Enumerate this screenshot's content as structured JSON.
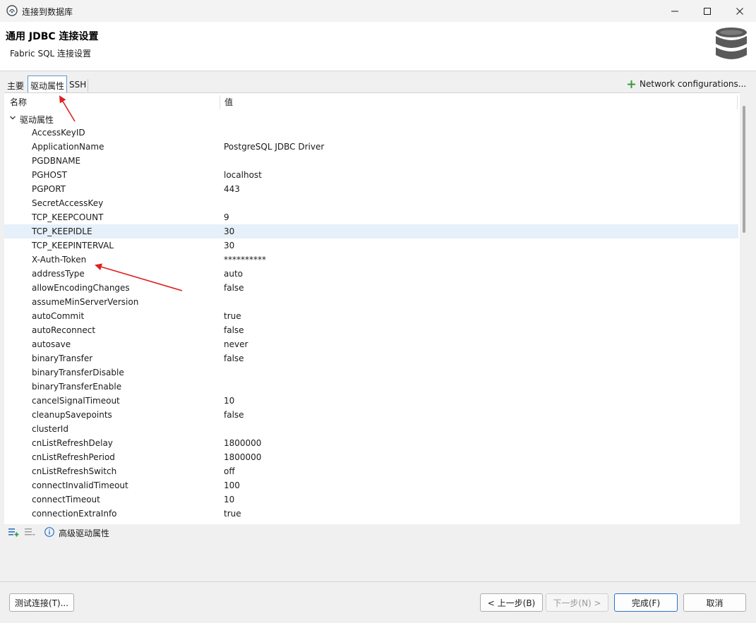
{
  "window": {
    "title": "连接到数据库",
    "accent_color": "#2a72c8"
  },
  "header": {
    "title": "通用 JDBC 连接设置",
    "subtitle": "Fabric SQL 连接设置"
  },
  "tabs": [
    {
      "label": "主要"
    },
    {
      "label": "驱动属性",
      "active": true
    },
    {
      "label": "SSH"
    }
  ],
  "network_configurations": "Network configurations...",
  "table": {
    "col_name": "名称",
    "col_value": "值",
    "group": "驱动属性",
    "rows": [
      {
        "name": "AccessKeyID",
        "value": ""
      },
      {
        "name": "ApplicationName",
        "value": "PostgreSQL JDBC Driver"
      },
      {
        "name": "PGDBNAME",
        "value": ""
      },
      {
        "name": "PGHOST",
        "value": "localhost"
      },
      {
        "name": "PGPORT",
        "value": "443"
      },
      {
        "name": "SecretAccessKey",
        "value": ""
      },
      {
        "name": "TCP_KEEPCOUNT",
        "value": "9"
      },
      {
        "name": "TCP_KEEPIDLE",
        "value": "30",
        "selected": true
      },
      {
        "name": "TCP_KEEPINTERVAL",
        "value": "30"
      },
      {
        "name": "X-Auth-Token",
        "value": "**********"
      },
      {
        "name": "addressType",
        "value": "auto"
      },
      {
        "name": "allowEncodingChanges",
        "value": "false"
      },
      {
        "name": "assumeMinServerVersion",
        "value": ""
      },
      {
        "name": "autoCommit",
        "value": "true"
      },
      {
        "name": "autoReconnect",
        "value": "false"
      },
      {
        "name": "autosave",
        "value": "never"
      },
      {
        "name": "binaryTransfer",
        "value": "false"
      },
      {
        "name": "binaryTransferDisable",
        "value": ""
      },
      {
        "name": "binaryTransferEnable",
        "value": ""
      },
      {
        "name": "cancelSignalTimeout",
        "value": "10"
      },
      {
        "name": "cleanupSavepoints",
        "value": "false"
      },
      {
        "name": "clusterId",
        "value": ""
      },
      {
        "name": "cnListRefreshDelay",
        "value": "1800000"
      },
      {
        "name": "cnListRefreshPeriod",
        "value": "1800000"
      },
      {
        "name": "cnListRefreshSwitch",
        "value": "off"
      },
      {
        "name": "connectInvalidTimeout",
        "value": "100"
      },
      {
        "name": "connectTimeout",
        "value": "10"
      },
      {
        "name": "connectionExtraInfo",
        "value": "true"
      }
    ]
  },
  "advanced_properties": "高级驱动属性",
  "icons": {
    "add_property": "add-property-icon",
    "remove_property": "remove-property-icon",
    "info": "info-icon",
    "database": "database-icon"
  },
  "buttons": {
    "test": "测试连接(T)...",
    "prev": "< 上一步(B)",
    "next": "下一步(N) >",
    "finish": "完成(F)",
    "cancel": "取消"
  }
}
